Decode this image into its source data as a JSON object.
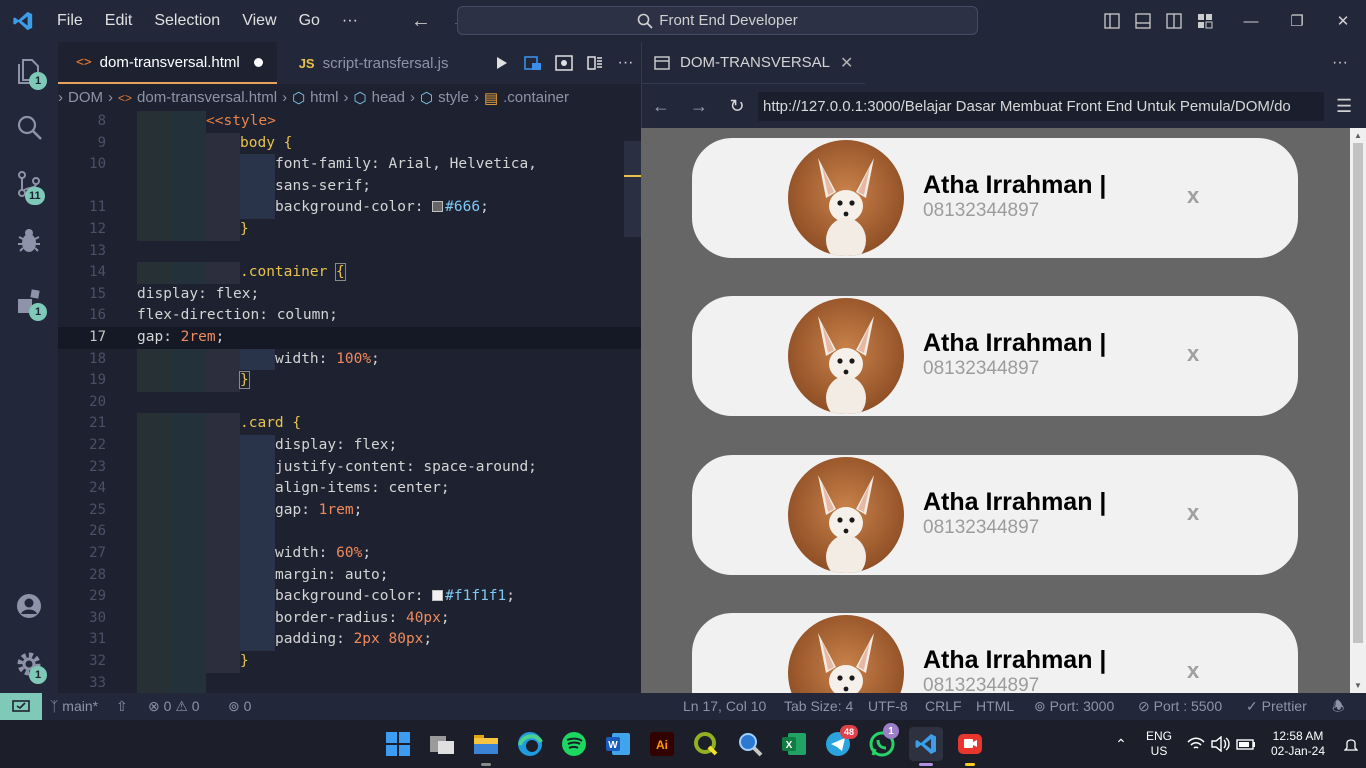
{
  "app": {
    "menu": [
      "File",
      "Edit",
      "Selection",
      "View",
      "Go",
      "···"
    ],
    "search_text": "Front End Developer"
  },
  "activity": {
    "explorer_badge": "1",
    "scm_badge": "11",
    "extensions_badge": "1",
    "settings_badge": "1"
  },
  "editor": {
    "tabs": [
      {
        "label": "dom-transversal.html",
        "icon": "html-file-icon",
        "modified": true
      },
      {
        "label": "script-transfersal.js",
        "icon": "JS"
      }
    ],
    "breadcrumb": [
      "DOM",
      "dom-transversal.html",
      "html",
      "head",
      "style",
      ".container"
    ],
    "lines": [
      {
        "n": "8"
      },
      {
        "n": "9"
      },
      {
        "n": "10"
      },
      {
        "n": ""
      },
      {
        "n": "11"
      },
      {
        "n": "12"
      },
      {
        "n": "13"
      },
      {
        "n": "14"
      },
      {
        "n": "15"
      },
      {
        "n": "16"
      },
      {
        "n": "17"
      },
      {
        "n": "18"
      },
      {
        "n": "19"
      },
      {
        "n": "20"
      },
      {
        "n": "21"
      },
      {
        "n": "22"
      },
      {
        "n": "23"
      },
      {
        "n": "24"
      },
      {
        "n": "25"
      },
      {
        "n": "26"
      },
      {
        "n": "27"
      },
      {
        "n": "28"
      },
      {
        "n": "29"
      },
      {
        "n": "30"
      },
      {
        "n": "31"
      },
      {
        "n": "32"
      },
      {
        "n": "33"
      }
    ],
    "code": {
      "l8_tag": "<style>",
      "l9_sel": "body",
      "l10a_prop": "font-family",
      "l10a_val": "Arial, Helvetica,",
      "l10b_val": "sans-serif;",
      "l11_prop": "background-color",
      "l11_val": "#666",
      "l12_brace": "}",
      "l14_sel": ".container",
      "l15_prop": "display",
      "l15_val": "flex;",
      "l16_prop": "flex-direction",
      "l16_val": "column;",
      "l17_prop": "gap",
      "l17_val": "2rem",
      "l18_prop": "width",
      "l18_val": "100%",
      "l19_brace": "}",
      "l21_sel": ".card",
      "l22_prop": "display",
      "l22_val": "flex;",
      "l23_prop": "justify-content",
      "l23_val": "space-around;",
      "l24_prop": "align-items",
      "l24_val": "center;",
      "l25_prop": "gap",
      "l25_val": "1rem",
      "l27_prop": "width",
      "l27_val": "60%",
      "l28_prop": "margin",
      "l28_val": "auto;",
      "l29_prop": "background-color",
      "l29_val": "#f1f1f1",
      "l30_prop": "border-radius",
      "l30_val": "40px",
      "l31_prop": "padding",
      "l31_val": "2px 80px",
      "l32_brace": "}"
    }
  },
  "browser": {
    "tab_title": "DOM-TRANSVERSAL",
    "url": "http://127.0.0.1:3000/Belajar Dasar Membuat Front End Untuk Pemula/DOM/do",
    "page_bg": "#666666",
    "cards": [
      {
        "name": "Atha Irrahman |",
        "phone": "08132344897",
        "close": "x"
      },
      {
        "name": "Atha Irrahman |",
        "phone": "08132344897",
        "close": "x"
      },
      {
        "name": "Atha Irrahman |",
        "phone": "08132344897",
        "close": "x"
      },
      {
        "name": "Atha Irrahman |",
        "phone": "08132344897",
        "close": "x"
      }
    ]
  },
  "status": {
    "branch": "main*",
    "errors": "0",
    "warnings": "0",
    "ports_count": "0",
    "position": "Ln 17, Col 10",
    "tab_size": "Tab Size: 4",
    "encoding": "UTF-8",
    "eol": "CRLF",
    "language": "HTML",
    "port1": "Port: 3000",
    "port2": "Port : 5500",
    "prettier": "Prettier"
  },
  "taskbar": {
    "telegram_badge": "48",
    "whatsapp_badge": "1",
    "lang": "ENG",
    "region": "US",
    "time": "12:58 AM",
    "date": "02-Jan-24"
  }
}
